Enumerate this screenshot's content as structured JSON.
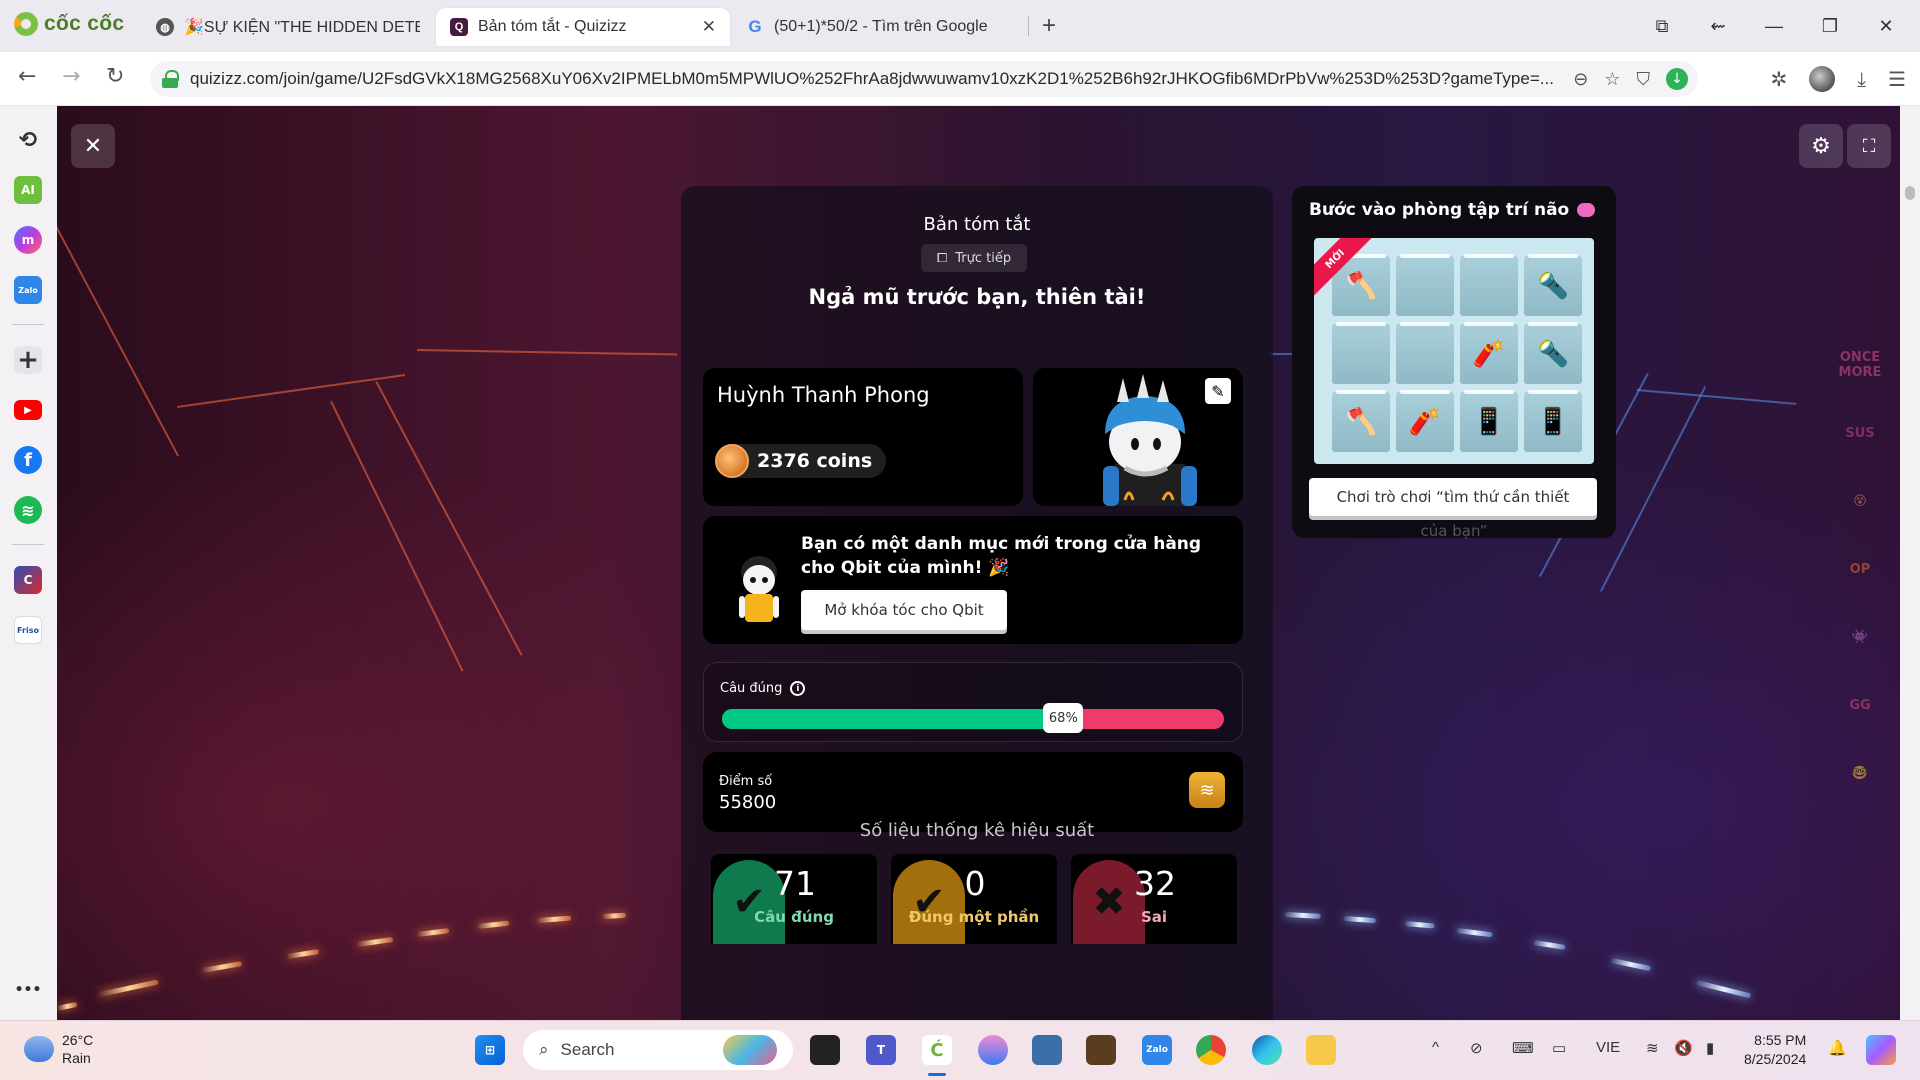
{
  "browser": {
    "brand": "cốc cốc",
    "tabs": [
      {
        "title": "🎉SỰ KIỆN \"THE HIDDEN DETECT",
        "active": false
      },
      {
        "title": "Bản tóm tắt - Quizizz",
        "active": true
      },
      {
        "title": "(50+1)*50/2 - Tìm trên Google",
        "active": false
      }
    ],
    "new_tab": "+",
    "url": "quizizz.com/join/game/U2FsdGVkX18MG2568XuY06Xv2IPMELbM0m5MPWlUO%252FhrAa8jdwwuwamv10xzK2D1%252B6h92rJHKOGfib6MDrPbVw%253D%253D?gameType=...",
    "window_controls": [
      "minimize",
      "restore",
      "close"
    ]
  },
  "sidebar": {
    "items": [
      {
        "name": "history",
        "label": "⟲"
      },
      {
        "name": "ai",
        "label": "AI"
      },
      {
        "name": "messenger",
        "label": "m"
      },
      {
        "name": "zalo",
        "label": "Zalo"
      },
      {
        "name": "add",
        "label": "+"
      },
      {
        "name": "youtube",
        "label": "▶"
      },
      {
        "name": "facebook",
        "label": "f"
      },
      {
        "name": "spotify",
        "label": "≋"
      },
      {
        "name": "game-app",
        "label": "C"
      },
      {
        "name": "friso",
        "label": "Friso"
      }
    ],
    "more": "•••"
  },
  "game": {
    "close_label": "✕",
    "settings_label": "⚙",
    "fullscreen_label": "⛶",
    "summary": {
      "title": "Bản tóm tắt",
      "mode_chip": "Trực tiếp",
      "headline": "Ngả mũ trước bạn, thiên tài!",
      "player_name": "Huỳnh Thanh Phong",
      "coins": "2376 coins",
      "edit_label": "✎",
      "qbit_message": "Bạn có một danh mục mới trong cửa hàng cho Qbit của mình! 🎉",
      "qbit_button": "Mở khóa tóc cho Qbit",
      "accuracy_label": "Câu đúng",
      "accuracy_percent": 68,
      "accuracy_text": "68%",
      "score_label": "Điểm số",
      "score_value": "55800",
      "performance_title": "Số liệu thống kê hiệu suất",
      "stats": [
        {
          "value": "71",
          "label": "Câu đúng",
          "icon": "✔",
          "color": "#0f7a4e",
          "label_color": "#7fd9b2"
        },
        {
          "value": "0",
          "label": "Đúng một phần",
          "icon": "✔",
          "color": "#a36f0d",
          "label_color": "#f0c86a"
        },
        {
          "value": "32",
          "label": "Sai",
          "icon": "✖",
          "color": "#7a1a2a",
          "label_color": "#f4a9b4"
        }
      ]
    },
    "brain_gym": {
      "title": "Bước vào phòng tập trí não",
      "ribbon": "MỚI",
      "grid": [
        "🪓",
        "",
        "",
        "🔦",
        "",
        "",
        "🧨",
        "🔦",
        "🪓",
        "🧨",
        "📱",
        "📱"
      ],
      "button": "Chơi trò chơi “tìm thứ cần thiết",
      "button_overflow": "của bạn”"
    },
    "reactions": [
      {
        "name": "once-more",
        "label": "ONCE MORE",
        "color": "#d94d8a"
      },
      {
        "name": "sus",
        "label": "SUS",
        "color": "#c2477e"
      },
      {
        "name": "mind-blown",
        "label": "😵",
        "color": "#e7913a"
      },
      {
        "name": "op",
        "label": "OP",
        "color": "#e36b2c"
      },
      {
        "name": "crewmate",
        "label": "👾",
        "color": "#9b3fa8"
      },
      {
        "name": "gg",
        "label": "GG",
        "color": "#cf4e6a"
      },
      {
        "name": "nerd",
        "label": "🤓",
        "color": "#e8952e"
      }
    ]
  },
  "taskbar": {
    "weather_temp": "26°C",
    "weather_desc": "Rain",
    "search_placeholder": "Search",
    "language": "VIE",
    "time": "8:55 PM",
    "date": "8/25/2024"
  }
}
